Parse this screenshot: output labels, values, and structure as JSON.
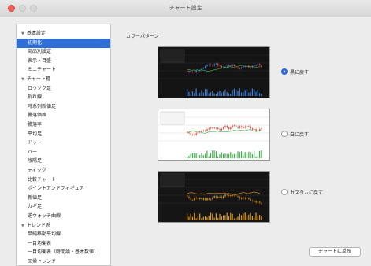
{
  "window": {
    "title": "チャート設定"
  },
  "sidebar": {
    "items": [
      {
        "label": "基本設定",
        "level": 0,
        "expanded": true
      },
      {
        "label": "初期化",
        "level": 1,
        "selected": true
      },
      {
        "label": "商品別設定",
        "level": 1
      },
      {
        "label": "表示・目盛",
        "level": 1
      },
      {
        "label": "ミニチャート",
        "level": 1
      },
      {
        "label": "チャート種",
        "level": 0,
        "expanded": true
      },
      {
        "label": "ロウソク足",
        "level": 1
      },
      {
        "label": "折れ線",
        "level": 1
      },
      {
        "label": "時系列新値足",
        "level": 1
      },
      {
        "label": "騰落価格",
        "level": 1
      },
      {
        "label": "騰落率",
        "level": 1
      },
      {
        "label": "平均足",
        "level": 1
      },
      {
        "label": "ドット",
        "level": 1
      },
      {
        "label": "バー",
        "level": 1
      },
      {
        "label": "陰陽足",
        "level": 1
      },
      {
        "label": "ティック",
        "level": 1
      },
      {
        "label": "比較チャート",
        "level": 1
      },
      {
        "label": "ポイントアンドフィギュア",
        "level": 1
      },
      {
        "label": "新値足",
        "level": 1
      },
      {
        "label": "カギ足",
        "level": 1
      },
      {
        "label": "逆ウォッチ曲線",
        "level": 1
      },
      {
        "label": "トレンド系",
        "level": 0,
        "expanded": true
      },
      {
        "label": "単純移動平均線",
        "level": 1
      },
      {
        "label": "一目均衡表",
        "level": 1
      },
      {
        "label": "一目均衡表（時間論・基本数値）",
        "level": 1
      },
      {
        "label": "回帰トレンド",
        "level": 1
      }
    ]
  },
  "main": {
    "section_label": "カラーパターン",
    "options": [
      {
        "label": "黒に戻す",
        "selected": true,
        "theme": "black"
      },
      {
        "label": "白に戻す",
        "selected": false,
        "theme": "white"
      },
      {
        "label": "カスタムに戻す",
        "selected": false,
        "theme": "custom"
      }
    ],
    "apply_button": "チャートに反映"
  },
  "colors": {
    "selection": "#2f6ed6",
    "radio_on": "#2f75e8",
    "close": "#ed5f5a",
    "black_bg": "#141414",
    "white_bg": "#ffffff",
    "custom_bg": "#151515",
    "price_blue": "#3f7fd6",
    "price_red": "#d94a3a",
    "ma_green": "#3fae4a",
    "ma_orange": "#e8932a",
    "custom_gold": "#e0a020"
  }
}
